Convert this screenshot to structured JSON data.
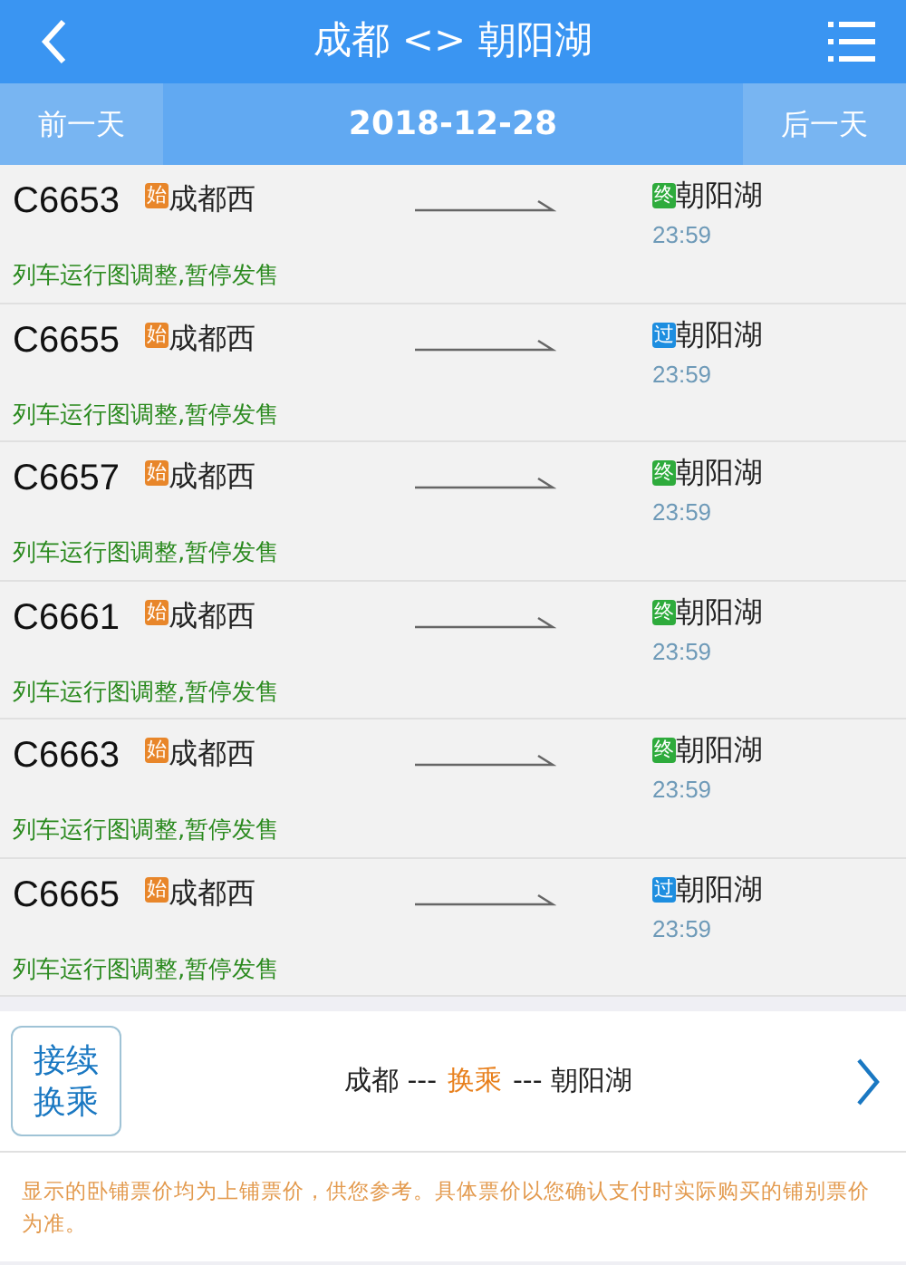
{
  "header": {
    "title": "成都 <> 朝阳湖"
  },
  "date_bar": {
    "prev": "前一天",
    "date": "2018-12-28",
    "next": "后一天"
  },
  "trains": [
    {
      "number": "C6653",
      "start_badge": "始",
      "from": "成都西",
      "end_badge": {
        "text": "终",
        "kind": "terminal"
      },
      "to": "朝阳湖",
      "time": "23:59",
      "status": "列车运行图调整,暂停发售"
    },
    {
      "number": "C6655",
      "start_badge": "始",
      "from": "成都西",
      "end_badge": {
        "text": "过",
        "kind": "pass"
      },
      "to": "朝阳湖",
      "time": "23:59",
      "status": "列车运行图调整,暂停发售"
    },
    {
      "number": "C6657",
      "start_badge": "始",
      "from": "成都西",
      "end_badge": {
        "text": "终",
        "kind": "terminal"
      },
      "to": "朝阳湖",
      "time": "23:59",
      "status": "列车运行图调整,暂停发售"
    },
    {
      "number": "C6661",
      "start_badge": "始",
      "from": "成都西",
      "end_badge": {
        "text": "终",
        "kind": "terminal"
      },
      "to": "朝阳湖",
      "time": "23:59",
      "status": "列车运行图调整,暂停发售"
    },
    {
      "number": "C6663",
      "start_badge": "始",
      "from": "成都西",
      "end_badge": {
        "text": "终",
        "kind": "terminal"
      },
      "to": "朝阳湖",
      "time": "23:59",
      "status": "列车运行图调整,暂停发售"
    },
    {
      "number": "C6665",
      "start_badge": "始",
      "from": "成都西",
      "end_badge": {
        "text": "过",
        "kind": "pass"
      },
      "to": "朝阳湖",
      "time": "23:59",
      "status": "列车运行图调整,暂停发售"
    }
  ],
  "transfer": {
    "button": "接续换乘",
    "parts": [
      {
        "text": "成都 ---",
        "kind": "plain"
      },
      {
        "text": "换乘",
        "kind": "highlight"
      },
      {
        "text": "--- 朝阳湖",
        "kind": "plain"
      }
    ]
  },
  "notice": "显示的卧铺票价均为上铺票价，供您参考。具体票价以您确认支付时实际购买的铺别票价为准。"
}
